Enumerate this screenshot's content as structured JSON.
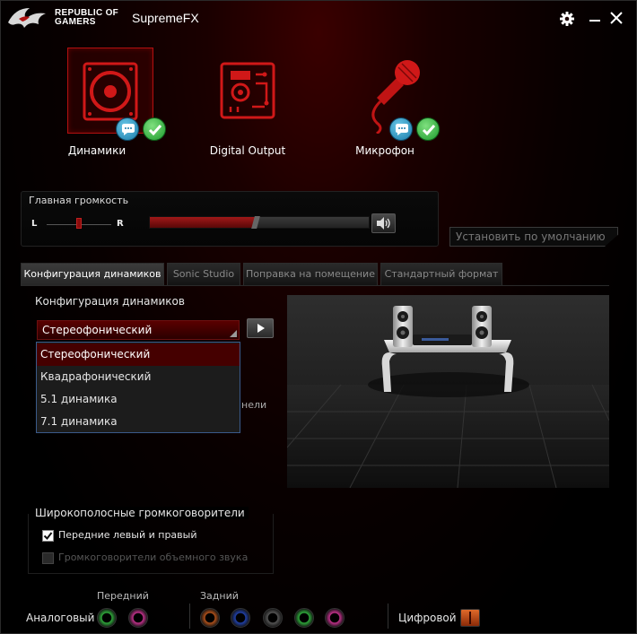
{
  "window": {
    "brand": "REPUBLIC OF GAMERS",
    "title": "SupremeFX"
  },
  "devices": [
    {
      "label": "Динамики",
      "selected": true
    },
    {
      "label": "Digital Output",
      "selected": false
    },
    {
      "label": "Микрофон",
      "selected": false
    }
  ],
  "volume": {
    "title": "Главная громкость",
    "left_label": "L",
    "right_label": "R",
    "level": 0.48
  },
  "default_button": "Установить по умолчанию",
  "tabs": [
    {
      "label": "Конфигурация динамиков",
      "active": true
    },
    {
      "label": "Sonic Studio",
      "active": false
    },
    {
      "label": "Поправка на помещение",
      "active": false
    },
    {
      "label": "Стандартный формат",
      "active": false
    }
  ],
  "speaker_config": {
    "label": "Конфигурация динамиков",
    "selected": "Стереофонический",
    "options": [
      "Стереофонический",
      "Квадрафонический",
      "5.1 динамика",
      "7.1 динамика"
    ],
    "hidden_text": "нели"
  },
  "wideband": {
    "title": "Широкополосные громкоговорители",
    "front": {
      "label": "Передние левый и правый",
      "checked": true
    },
    "surround": {
      "label": "Громкоговорители объемного звука",
      "checked": false
    }
  },
  "jacks": {
    "front_label": "Передний",
    "rear_label": "Задний",
    "analog_label": "Аналоговый",
    "digital_label": "Цифровой",
    "colors": {
      "front": [
        "#2ea83a",
        "#c0308a"
      ],
      "rear": [
        "#b0501a",
        "#2040a8",
        "#555555",
        "#2ea83a",
        "#c0308a"
      ],
      "digital": "#e06a2a"
    }
  },
  "colors": {
    "accent": "#b01010",
    "badge_chat": "#1a7aa8",
    "badge_ok": "#1c9a2c"
  }
}
